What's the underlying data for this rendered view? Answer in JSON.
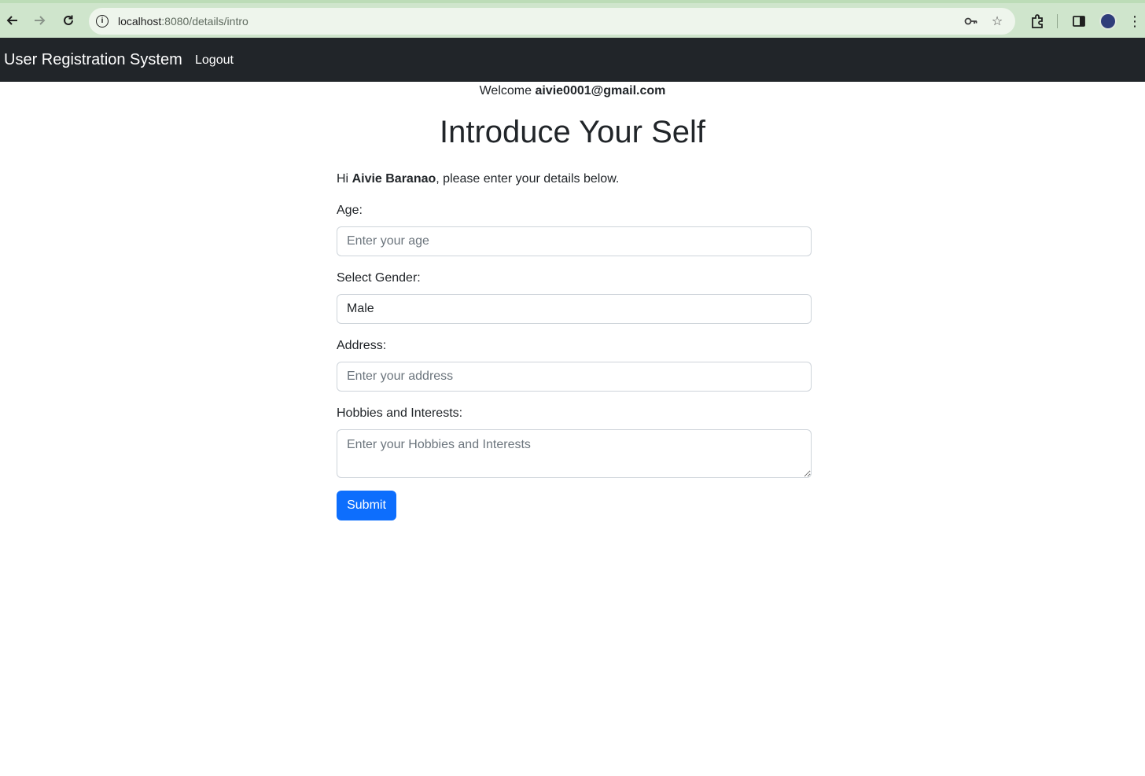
{
  "browser": {
    "url_host": "localhost",
    "url_path": ":8080/details/intro",
    "icons": {
      "back": "back-arrow-icon",
      "forward": "forward-arrow-icon",
      "reload": "reload-icon",
      "site_info": "info-icon",
      "password": "key-icon",
      "bookmark": "star-icon",
      "extensions": "puzzle-icon",
      "side_panel": "side-panel-icon",
      "menu": "kebab-menu-icon"
    },
    "accent_color": "#cfe5cc"
  },
  "navbar": {
    "brand": "User Registration System",
    "logout_label": "Logout",
    "background": "#212529"
  },
  "welcome": {
    "prefix": "Welcome",
    "email": "aivie0001@gmail.com"
  },
  "page": {
    "title": "Introduce Your Self",
    "intro_prefix": "Hi",
    "user_name": "Aivie Baranao",
    "intro_suffix": ", please enter your details below."
  },
  "form": {
    "age": {
      "label": "Age:",
      "placeholder": "Enter your age",
      "value": ""
    },
    "gender": {
      "label": "Select Gender:",
      "selected": "Male"
    },
    "address": {
      "label": "Address:",
      "placeholder": "Enter your address",
      "value": ""
    },
    "hobbies": {
      "label": "Hobbies and Interests:",
      "placeholder": "Enter your Hobbies and Interests",
      "value": ""
    },
    "submit_label": "Submit",
    "submit_color": "#0d6efd"
  }
}
